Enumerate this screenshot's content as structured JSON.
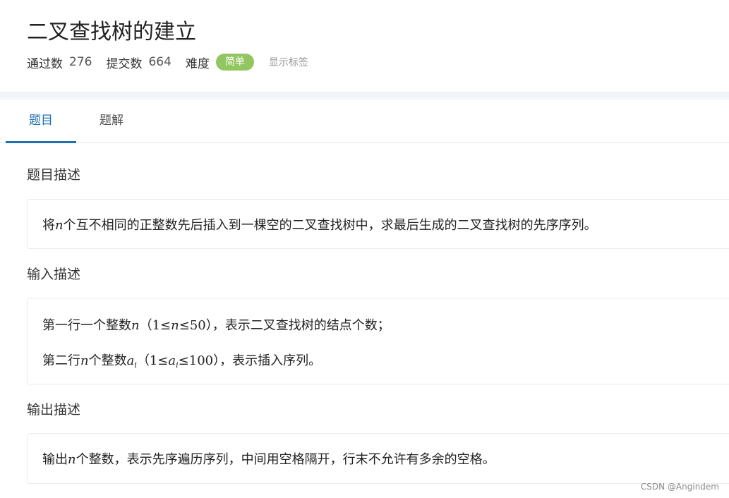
{
  "header": {
    "title": "二叉查找树的建立",
    "stats": {
      "passed_label": "通过数",
      "passed_value": "276",
      "submitted_label": "提交数",
      "submitted_value": "664",
      "difficulty_label": "难度",
      "difficulty_value": "简单",
      "show_tags": "显示标签"
    }
  },
  "tabs": [
    {
      "label": "题目",
      "active": true
    },
    {
      "label": "题解",
      "active": false
    }
  ],
  "sections": {
    "description": {
      "heading": "题目描述",
      "text_a": "将",
      "var": "n",
      "text_b": "个互不相同的正整数先后插入到一棵空的二叉查找树中，求最后生成的二叉查找树的先序序列。"
    },
    "input": {
      "heading": "输入描述",
      "line1_a": "第一行一个整数",
      "line1_var": "n",
      "line1_paren_open": "（",
      "line1_range_a": "1≤",
      "line1_range_var": "n",
      "line1_range_b": "≤50",
      "line1_paren_close": "）",
      "line1_b": "，表示二叉查找树的结点个数；",
      "line2_a": "第二行",
      "line2_var": "n",
      "line2_b": "个整数",
      "line2_var2": "a",
      "line2_sub": "i",
      "line2_paren_open": "（",
      "line2_range_a": "1≤",
      "line2_range_var": "a",
      "line2_range_sub": "i",
      "line2_range_b": "≤100",
      "line2_paren_close": "）",
      "line2_c": "，表示插入序列。"
    },
    "output": {
      "heading": "输出描述",
      "text_a": "输出",
      "var": "n",
      "text_b": "个整数，表示先序遍历序列，中间用空格隔开，行末不允许有多余的空格。"
    }
  },
  "watermark": "CSDN @Angindem",
  "colors": {
    "accent": "#1f6fb5",
    "badge": "#91c660",
    "border": "#e8ebef"
  }
}
